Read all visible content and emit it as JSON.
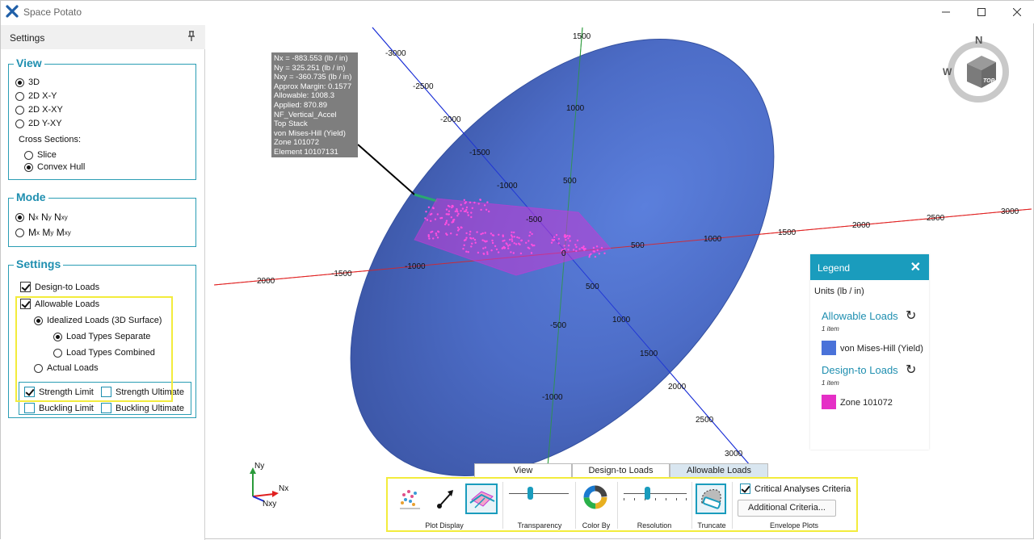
{
  "app": {
    "title": "Space Potato"
  },
  "sidebar": {
    "title": "Settings",
    "view": {
      "legend": "View",
      "options": [
        "3D",
        "2D X-Y",
        "2D X-XY",
        "2D Y-XY"
      ],
      "cross_sections_label": "Cross Sections:",
      "cross_sections": [
        "Slice",
        "Convex Hull"
      ]
    },
    "mode": {
      "legend": "Mode",
      "option1": {
        "a": "N",
        "as": "x",
        "b": "N",
        "bs": "y",
        "c": "N",
        "cs": "xy"
      },
      "option2": {
        "a": "M",
        "as": "x",
        "b": "M",
        "bs": "y",
        "c": "M",
        "cs": "xy"
      }
    },
    "settings": {
      "legend": "Settings",
      "design_to_loads": "Design-to Loads",
      "allowable_loads": "Allowable Loads",
      "idealized": "Idealized Loads (3D Surface)",
      "separate": "Load Types Separate",
      "combined": "Load Types Combined",
      "actual": "Actual Loads",
      "strength_limit": "Strength Limit",
      "strength_ultimate": "Strength Ultimate",
      "buckling_limit": "Buckling Limit",
      "buckling_ultimate": "Buckling Ultimate"
    }
  },
  "tooltip": {
    "lines": [
      "Nx = -883.553 (lb / in)",
      "Ny = 325.251 (lb / in)",
      "Nxy = -360.735 (lb / in)",
      "Approx Margin: 0.1577",
      "Allowable: 1008.3",
      "Applied: 870.89",
      "NF_Vertical_Accel",
      "Top Stack",
      "von Mises-Hill (Yield)",
      "Zone 101072",
      "Element 10107131"
    ]
  },
  "axes": {
    "blue": [
      "-3000",
      "-2500",
      "-2000",
      "-1500",
      "-1000",
      "-500",
      "0",
      "500",
      "1000",
      "1500",
      "2000",
      "2500",
      "3000"
    ],
    "green": [
      "1500",
      "1000",
      "500",
      "-500",
      "-1000"
    ],
    "red": [
      "2000",
      "-1500",
      "-1000",
      "500",
      "1000",
      "1500",
      "2000",
      "2500",
      "3000"
    ]
  },
  "legend": {
    "title": "Legend",
    "close": "✕",
    "units": "Units (lb / in)",
    "allowable_title": "Allowable Loads",
    "allowable_count": "1 item",
    "allowable_item": "von Mises-Hill (Yield)",
    "allowable_color": "#4a72d9",
    "design_title": "Design-to Loads",
    "design_count": "1 item",
    "design_item": "Zone 101072",
    "design_color": "#e52fc6"
  },
  "compass": {
    "n": "N",
    "w": "W",
    "top": "TOP"
  },
  "triad": {
    "ny": "Ny",
    "nx": "Nx",
    "nxy": "Nxy"
  },
  "toolbar": {
    "tabs": [
      "View",
      "Design-to Loads",
      "Allowable Loads"
    ],
    "active_tab": "Allowable Loads",
    "groups": {
      "plot_display": "Plot Display",
      "transparency": "Transparency",
      "color_by": "Color By",
      "resolution": "Resolution",
      "truncate": "Truncate",
      "envelope": "Envelope Plots"
    },
    "critical": "Critical Analyses Criteria",
    "additional": "Additional Criteria..."
  },
  "colors": {
    "accent": "#1a9cbd",
    "surface": "#4a6ac3",
    "load_points": "#e52fc6",
    "highlight": "#f3ec3c"
  }
}
